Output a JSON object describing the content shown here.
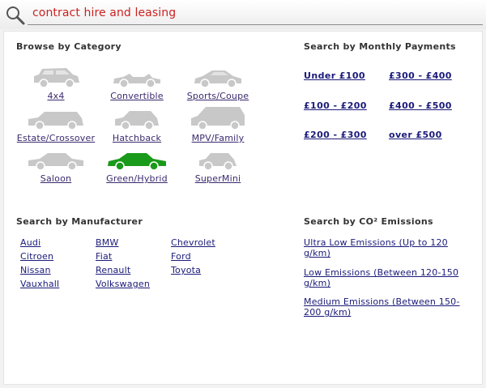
{
  "search": {
    "query": "contract hire and leasing"
  },
  "browse_category": {
    "title": "Browse by Category",
    "items": [
      {
        "label": "4x4",
        "icon": "suv-icon"
      },
      {
        "label": "Convertible",
        "icon": "convertible-icon"
      },
      {
        "label": "Sports/Coupe",
        "icon": "coupe-icon"
      },
      {
        "label": "Estate/Crossover",
        "icon": "estate-icon"
      },
      {
        "label": "Hatchback",
        "icon": "hatchback-icon"
      },
      {
        "label": "MPV/Family",
        "icon": "mpv-icon"
      },
      {
        "label": "Saloon",
        "icon": "saloon-icon"
      },
      {
        "label": "Green/Hybrid",
        "icon": "hybrid-icon"
      },
      {
        "label": "SuperMini",
        "icon": "supermini-icon"
      }
    ],
    "icon_color": "#c8c8c8",
    "highlight_color": "#1a9a1a"
  },
  "monthly_payments": {
    "title": "Search by Monthly Payments",
    "items": [
      "Under £100",
      "£300 - £400",
      "£100 - £200",
      "£400 - £500",
      "£200 - £300",
      "over £500"
    ]
  },
  "manufacturer": {
    "title": "Search by Manufacturer",
    "items": [
      "Audi",
      "BMW",
      "Chevrolet",
      "Citroen",
      "Fiat",
      "Ford",
      "Nissan",
      "Renault",
      "Toyota",
      "Vauxhall",
      "Volkswagen"
    ]
  },
  "co2": {
    "title": "Search by CO² Emissions",
    "items": [
      "Ultra Low Emissions (Up to 120 g/km)",
      "Low Emissions (Between 120-150 g/km)",
      "Medium Emissions (Between 150-200 g/km)"
    ]
  }
}
